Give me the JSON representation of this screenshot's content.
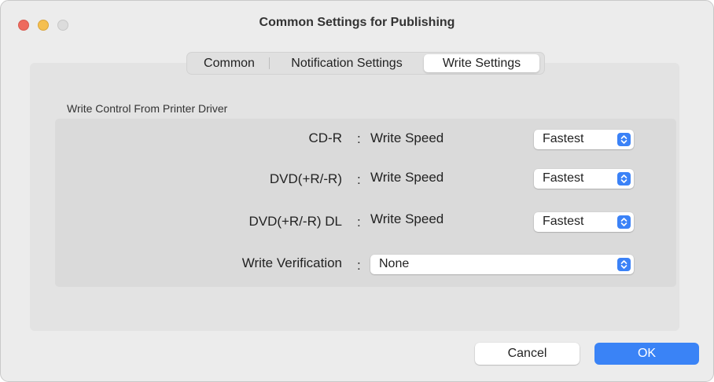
{
  "window": {
    "title": "Common Settings for Publishing"
  },
  "tabs": [
    {
      "label": "Common",
      "selected": false
    },
    {
      "label": "Notification Settings",
      "selected": false
    },
    {
      "label": "Write Settings",
      "selected": true
    }
  ],
  "section": {
    "label": "Write Control From Printer Driver"
  },
  "rows": [
    {
      "label": "CD-R",
      "colon": ":",
      "setting": "Write Speed",
      "value": "Fastest"
    },
    {
      "label": "DVD(+R/-R)",
      "colon": ":",
      "setting": "Write Speed",
      "value": "Fastest"
    },
    {
      "label": "DVD(+R/-R) DL",
      "colon": ":",
      "setting": "Write Speed",
      "value": "Fastest"
    }
  ],
  "verification": {
    "label": "Write Verification",
    "colon": ":",
    "value": "None"
  },
  "buttons": {
    "cancel": "Cancel",
    "ok": "OK"
  },
  "icons": {
    "close": "close-traffic-light-icon",
    "minimize": "minimize-traffic-light-icon",
    "zoom": "zoom-traffic-light-icon",
    "stepper": "up-down-chevron-icon"
  },
  "colors": {
    "accent": "#3a83f6",
    "close": "#ee6a5e",
    "minimize": "#f5bf4f",
    "zoom_inactive": "#dcdcdc"
  }
}
